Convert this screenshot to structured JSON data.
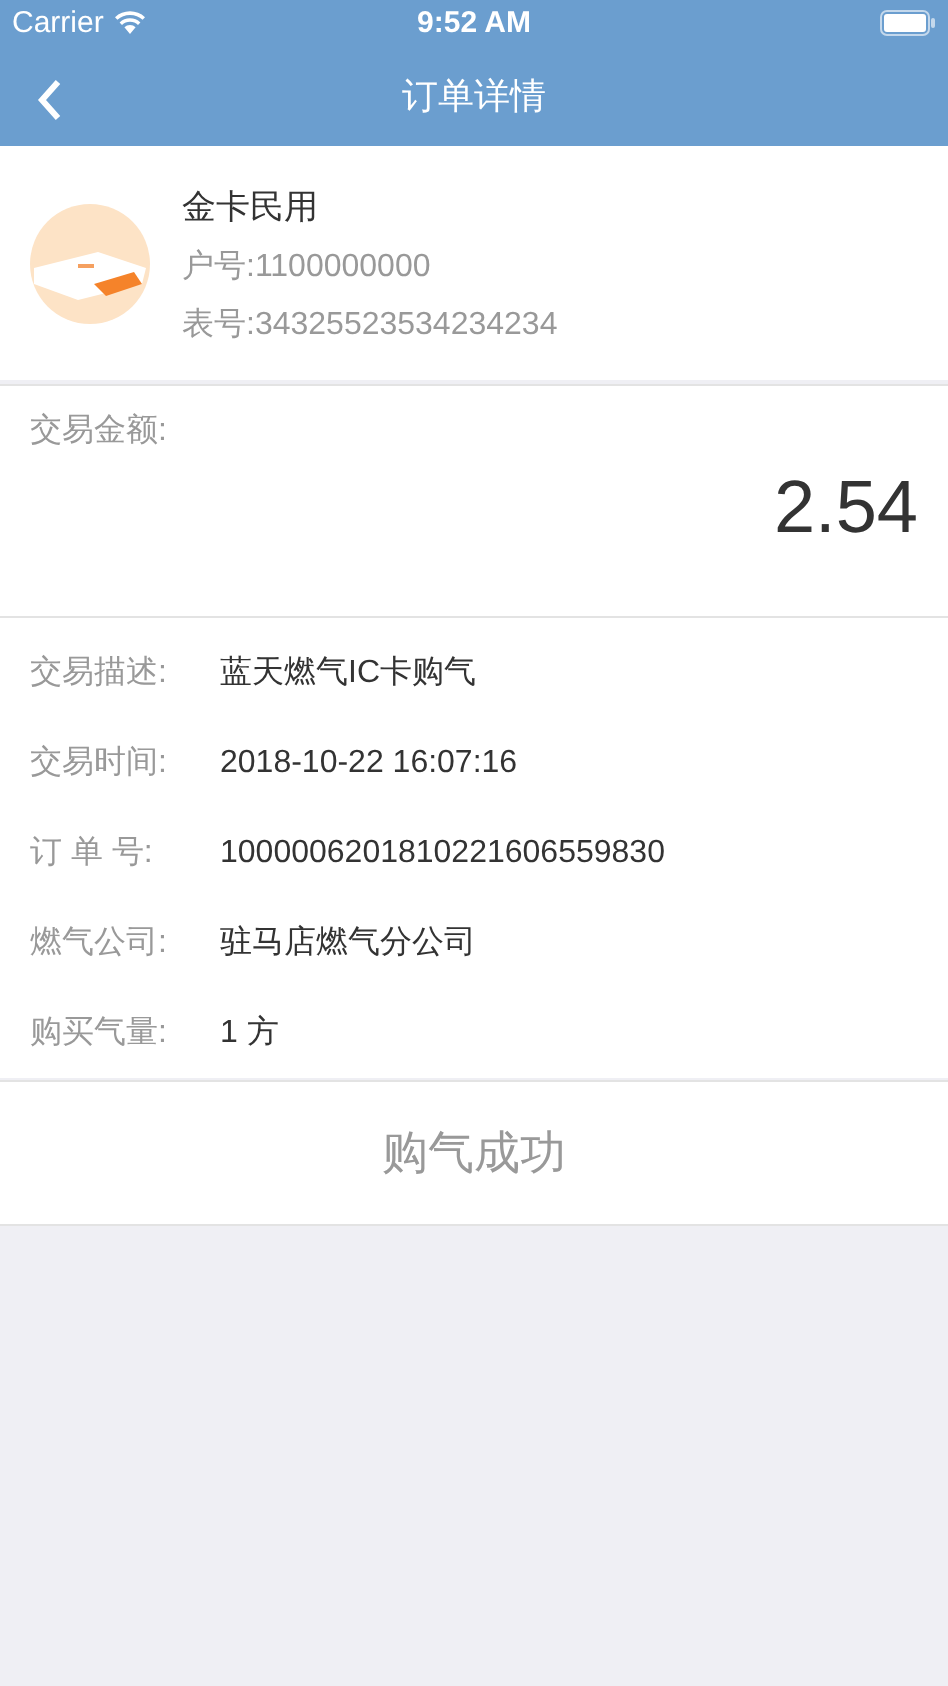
{
  "status_bar": {
    "carrier": "Carrier",
    "time": "9:52 AM"
  },
  "nav": {
    "title": "订单详情"
  },
  "account": {
    "name": "金卡民用",
    "account_no": "户号:1100000000",
    "meter_no": "表号:34325523534234234"
  },
  "amount": {
    "label": "交易金额:",
    "value": "2.54"
  },
  "details": [
    {
      "label": "交易描述:",
      "value": "蓝天燃气IC卡购气"
    },
    {
      "label": "交易时间:",
      "value": "2018-10-22 16:07:16"
    },
    {
      "label": "订 单 号:",
      "value": "1000006201810221606559830"
    },
    {
      "label": "燃气公司:",
      "value": "驻马店燃气分公司"
    },
    {
      "label": "购买气量:",
      "value": "1 方"
    }
  ],
  "result": {
    "text": "购气成功"
  }
}
